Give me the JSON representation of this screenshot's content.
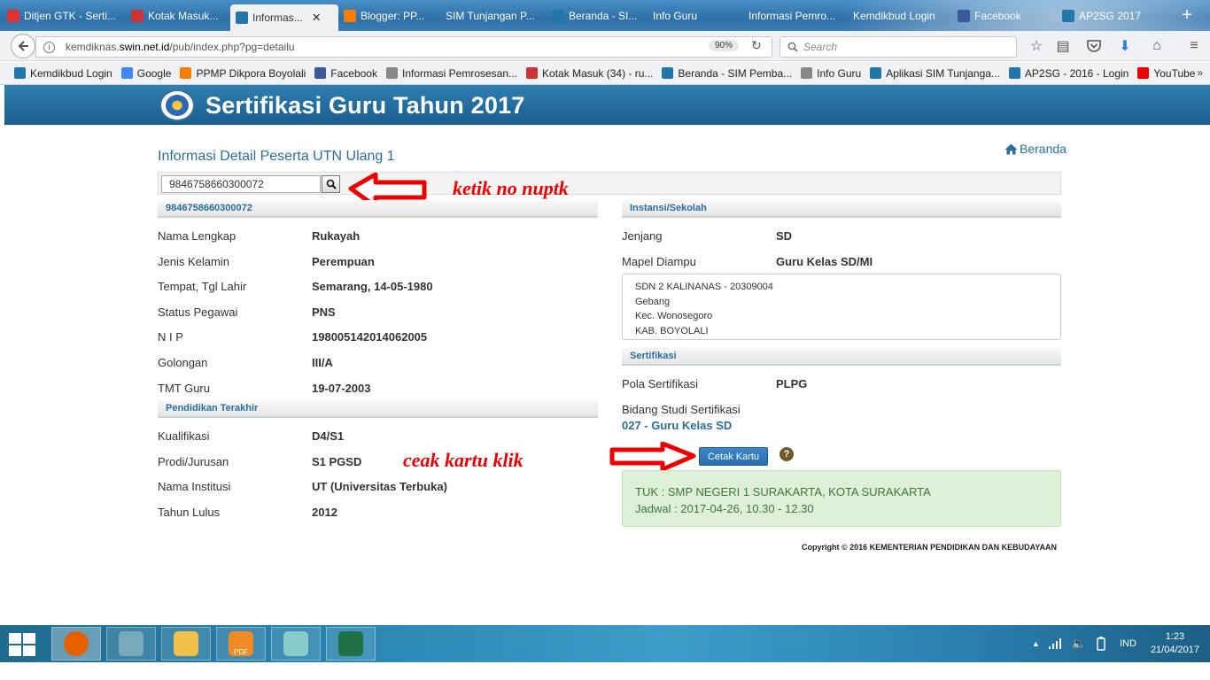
{
  "browser": {
    "tabs": [
      {
        "label": "Ditjen GTK - Serti...",
        "fav": "#d33"
      },
      {
        "label": "Kotak Masuk...",
        "fav": "#c33"
      },
      {
        "label": "Informas...",
        "fav": "#27a",
        "active": true
      },
      {
        "label": "Blogger: PP...",
        "fav": "#f57d00"
      },
      {
        "label": "SIM Tunjangan P...",
        "fav": ""
      },
      {
        "label": "Beranda - SI...",
        "fav": "#27a"
      },
      {
        "label": "Info Guru",
        "fav": ""
      },
      {
        "label": "Informasi Pemro...",
        "fav": ""
      },
      {
        "label": "Kemdikbud Login",
        "fav": ""
      },
      {
        "label": "Facebook",
        "fav": "#3b5998"
      },
      {
        "label": "AP2SG 2017",
        "fav": "#27a"
      }
    ],
    "tab_close": "✕",
    "new_tab": "+",
    "url_prefix": "kemdiknas.",
    "url_host": "swin.net.id",
    "url_path": "/pub/index.php?pg=detailu",
    "zoom": "90%",
    "search_placeholder": "Search",
    "bookmarks": [
      {
        "label": "Kemdikbud Login",
        "fav": "#27a"
      },
      {
        "label": "Google",
        "fav": "#4285f4"
      },
      {
        "label": "PPMP Dikpora Boyolali",
        "fav": "#f57d00"
      },
      {
        "label": "Facebook",
        "fav": "#3b5998"
      },
      {
        "label": "Informasi Pemrosesan...",
        "fav": "#888"
      },
      {
        "label": "Kotak Masuk (34) - ru...",
        "fav": "#c33"
      },
      {
        "label": "Beranda - SIM Pemba...",
        "fav": "#27a"
      },
      {
        "label": "Info Guru",
        "fav": "#888"
      },
      {
        "label": "Aplikasi SIM Tunjanga...",
        "fav": "#27a"
      },
      {
        "label": "AP2SG - 2016 - Login",
        "fav": "#27a"
      },
      {
        "label": "YouTube",
        "fav": "#e00"
      }
    ],
    "bookmarks_more": "»"
  },
  "site": {
    "title": "Sertifikasi Guru Tahun 2017",
    "heading": "Informasi Detail Peserta UTN Ulang 1",
    "home_link": "Beranda",
    "search_value": "9846758660300072",
    "copyright": "Copyright © 2016 KEMENTERIAN PENDIDIKAN DAN KEBUDAYAAN"
  },
  "annotations": {
    "type_nuptk": "ketik no nuptk",
    "click_card": "ceak kartu klik"
  },
  "left": {
    "section_header": "9846758660300072",
    "fields": [
      {
        "label": "Nama Lengkap",
        "value": "Rukayah"
      },
      {
        "label": "Jenis Kelamin",
        "value": "Perempuan"
      },
      {
        "label": "Tempat, Tgl Lahir",
        "value": "Semarang, 14-05-1980"
      },
      {
        "label": "Status Pegawai",
        "value": "PNS"
      },
      {
        "label": "N I P",
        "value": "198005142014062005"
      },
      {
        "label": "Golongan",
        "value": "III/A"
      },
      {
        "label": "TMT Guru",
        "value": "19-07-2003"
      }
    ],
    "education_header": "Pendidikan Terakhir",
    "education": [
      {
        "label": "Kualifikasi",
        "value": "D4/S1"
      },
      {
        "label": "Prodi/Jurusan",
        "value": "S1 PGSD"
      },
      {
        "label": "Nama Institusi",
        "value": "UT (Universitas Terbuka)"
      },
      {
        "label": "Tahun Lulus",
        "value": "2012"
      }
    ]
  },
  "right": {
    "section_header": "Instansi/Sekolah",
    "fields": [
      {
        "label": "Jenjang",
        "value": "SD"
      },
      {
        "label": "Mapel Diampu",
        "value": "Guru Kelas SD/MI"
      }
    ],
    "school": [
      "SDN 2 KALINANAS - 20309004",
      "Gebang",
      "Kec. Wonosegoro",
      "KAB. BOYOLALI"
    ],
    "cert_header": "Sertifikasi",
    "pola_label": "Pola Sertifikasi",
    "pola_value": "PLPG",
    "bidang_label": "Bidang Studi Sertifikasi",
    "bidang_value": "027 - Guru Kelas SD",
    "print_button": "Cetak Kartu",
    "help": "?",
    "tuk": "TUK : SMP NEGERI 1 SURAKARTA, KOTA SURAKARTA",
    "jadwal": "Jadwal : 2017-04-26, 10.30 - 12.30"
  },
  "taskbar": {
    "apps": [
      {
        "name": "firefox-icon",
        "color": "#e66000"
      },
      {
        "name": "paint-icon",
        "color": "#7ab"
      },
      {
        "name": "file-explorer-icon",
        "color": "#f0c24a"
      },
      {
        "name": "pdf-icon",
        "color": "#f08a24",
        "label": "PDF"
      },
      {
        "name": "notepad-icon",
        "color": "#8cc"
      },
      {
        "name": "excel-icon",
        "color": "#1e7145"
      }
    ],
    "tray_caret": "▲",
    "language": "IND",
    "time": "1:23",
    "date": "21/04/2017"
  }
}
